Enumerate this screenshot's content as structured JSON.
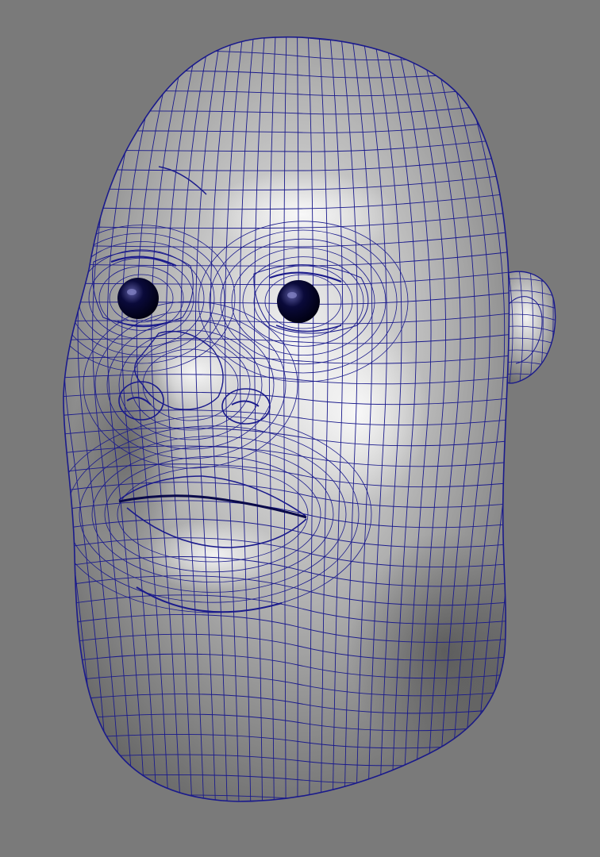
{
  "viewport": {
    "background_color": "#7a7a7a",
    "surface_highlight": "#f4f4f4",
    "surface_mid": "#b4b4b4",
    "surface_shadow": "#5c5c5c",
    "wire_color": "#1a1a8c",
    "eye_color": "#0a0a3a"
  },
  "model": {
    "subject": "head-mesh",
    "display_mode": "wireframe-on-shaded"
  }
}
